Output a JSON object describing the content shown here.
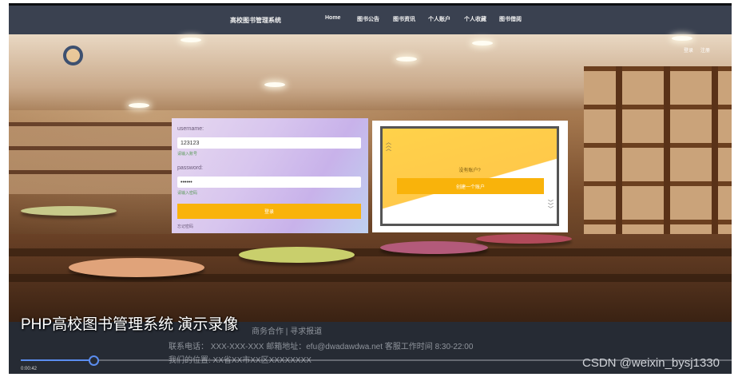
{
  "nav": {
    "site_title": "高校图书管理系统",
    "items": [
      {
        "label": "Home"
      },
      {
        "label": "图书公告"
      },
      {
        "label": "图书资讯"
      },
      {
        "label": "个人账户"
      },
      {
        "label": "个人收藏"
      },
      {
        "label": "图书借阅"
      }
    ]
  },
  "auth": {
    "login_label": "登录",
    "register_label": "注册"
  },
  "login_form": {
    "username_label": "username:",
    "username_value": "123123",
    "username_hint": "请输入账号",
    "password_label": "password:",
    "password_value": "••••••",
    "password_hint": "请输入密码",
    "submit_label": "登录",
    "forgot_label": "忘记密码"
  },
  "register_panel": {
    "question": "没有账户?",
    "button_label": "创建一个账户"
  },
  "footer": {
    "links": "商务合作 | 寻求报道",
    "contact": "联系电话：  XXX-XXX-XXX 邮箱地址：efu@dwadawdwa.net 客服工作时间 8:30-22:00",
    "location": "我们的位置: XX省XX市XX区XXXXXXXX"
  },
  "video": {
    "title": "PHP高校图书管理系统 演示录像",
    "current_time": "0:00:42",
    "progress": 0.102
  },
  "watermark": "CSDN @weixin_bysj1330",
  "colors": {
    "accent": "#f9b30b",
    "navbar": "#3a4150",
    "footer": "#262b34",
    "progress": "#5b8def"
  }
}
